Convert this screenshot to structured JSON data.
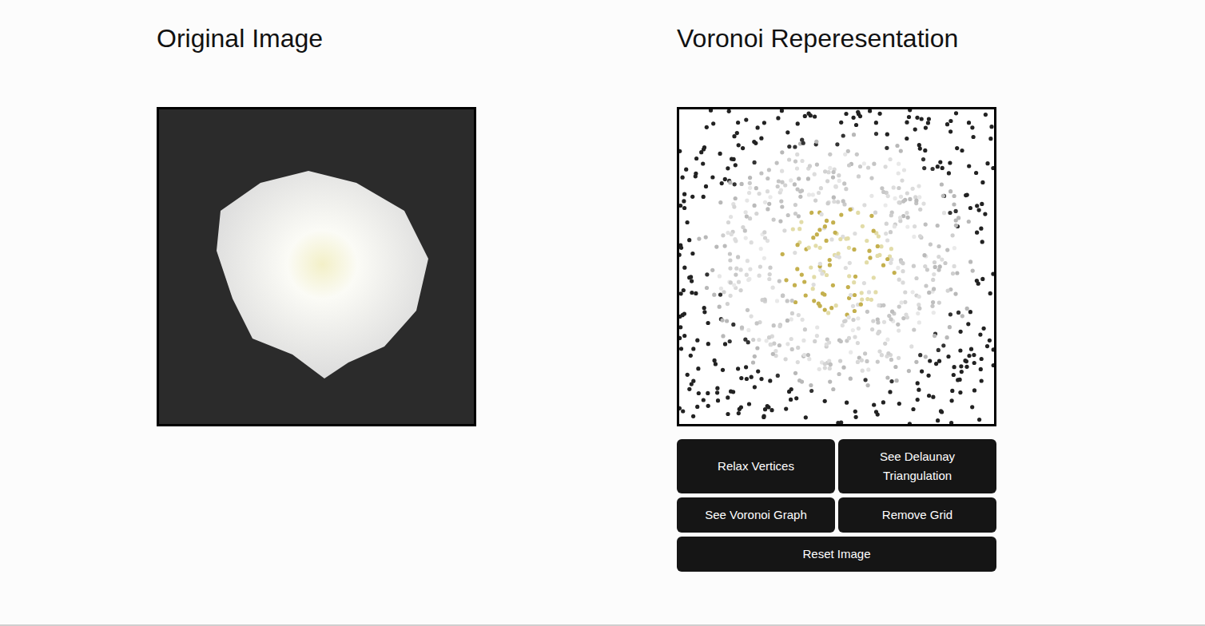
{
  "left": {
    "title": "Original Image"
  },
  "right": {
    "title": "Voronoi Reperesentation"
  },
  "buttons": [
    {
      "label": "Relax Vertices"
    },
    {
      "label": "See Delaunay Triangulation"
    },
    {
      "label": "See Voronoi Graph"
    },
    {
      "label": "Remove Grid"
    },
    {
      "label": "Reset Image"
    }
  ]
}
